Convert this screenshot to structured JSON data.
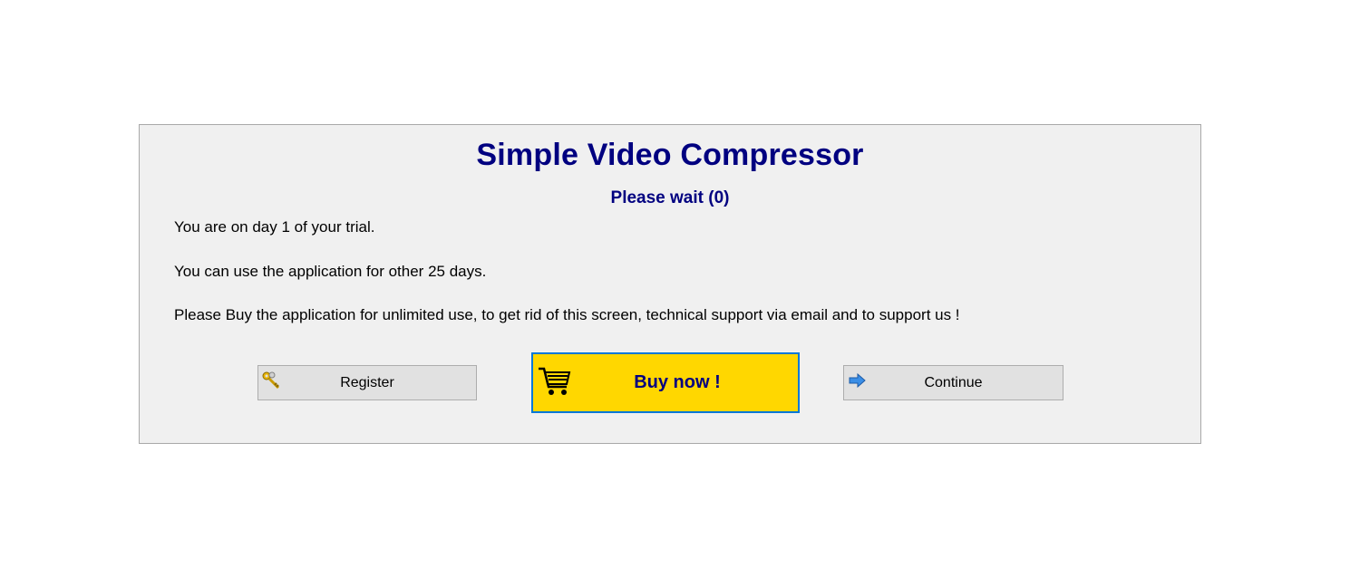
{
  "dialog": {
    "title": "Simple Video Compressor",
    "subtitle": "Please wait (0)",
    "messages": [
      "You are on day 1 of your trial.",
      "You can use the application for other 25 days.",
      "Please Buy the application for unlimited use, to get rid of this screen, technical support via email and to support us !"
    ]
  },
  "buttons": {
    "register": {
      "label": "Register",
      "icon": "keys-icon"
    },
    "buy": {
      "label": "Buy now !",
      "icon": "shopping-cart-icon"
    },
    "continue": {
      "label": "Continue",
      "icon": "arrow-right-icon"
    }
  },
  "colors": {
    "title": "#000080",
    "buy_background": "#ffd700",
    "buy_border": "#0078d7",
    "dialog_background": "#f0f0f0"
  }
}
